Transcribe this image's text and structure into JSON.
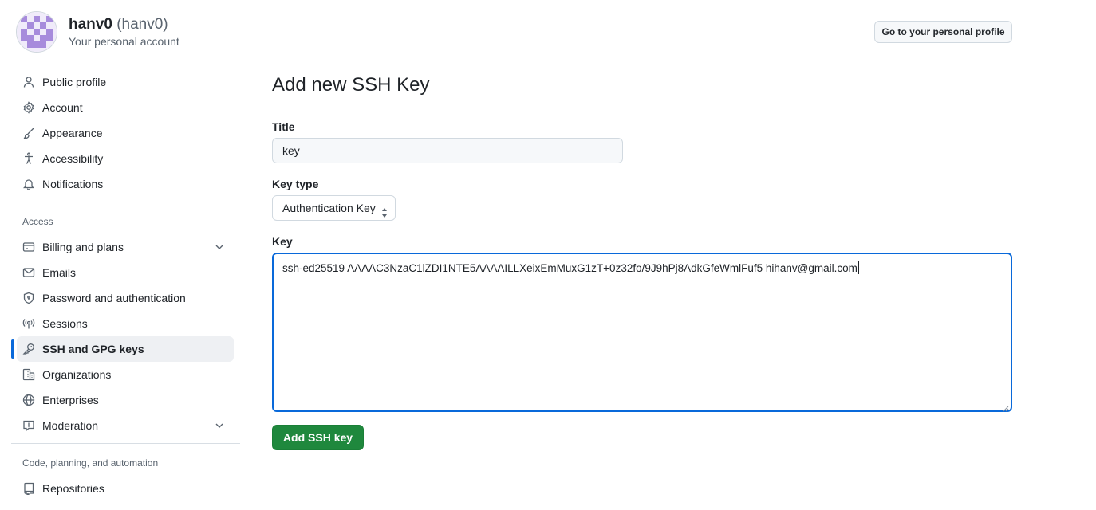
{
  "account": {
    "name": "hanv0",
    "login": "(hanv0)",
    "subtitle": "Your personal account",
    "profile_button": "Go to your personal profile"
  },
  "sidebar": {
    "items_top": [
      {
        "label": "Public profile",
        "icon": "person-icon"
      },
      {
        "label": "Account",
        "icon": "gear-icon"
      },
      {
        "label": "Appearance",
        "icon": "paintbrush-icon"
      },
      {
        "label": "Accessibility",
        "icon": "accessibility-icon"
      },
      {
        "label": "Notifications",
        "icon": "bell-icon"
      }
    ],
    "access_title": "Access",
    "items_access": [
      {
        "label": "Billing and plans",
        "icon": "credit-card-icon",
        "expandable": true
      },
      {
        "label": "Emails",
        "icon": "mail-icon"
      },
      {
        "label": "Password and authentication",
        "icon": "shield-lock-icon"
      },
      {
        "label": "Sessions",
        "icon": "broadcast-icon"
      },
      {
        "label": "SSH and GPG keys",
        "icon": "key-icon",
        "active": true
      },
      {
        "label": "Organizations",
        "icon": "organization-icon"
      },
      {
        "label": "Enterprises",
        "icon": "globe-icon"
      },
      {
        "label": "Moderation",
        "icon": "report-icon",
        "expandable": true
      }
    ],
    "code_title": "Code, planning, and automation",
    "items_code": [
      {
        "label": "Repositories",
        "icon": "repo-icon"
      }
    ]
  },
  "form": {
    "heading": "Add new SSH Key",
    "title_label": "Title",
    "title_value": "key",
    "key_type_label": "Key type",
    "key_type_value": "Authentication Key",
    "key_label": "Key",
    "key_value": "ssh-ed25519 AAAAC3NzaC1lZDI1NTE5AAAAILLXeixEmMuxG1zT+0z32fo/9J9hPj8AdkGfeWmlFuf5 hihanv@gmail.com",
    "submit_label": "Add SSH key"
  },
  "colors": {
    "accent": "#0969da",
    "primary_button": "#1f883d",
    "avatar": "#a78bdc"
  }
}
